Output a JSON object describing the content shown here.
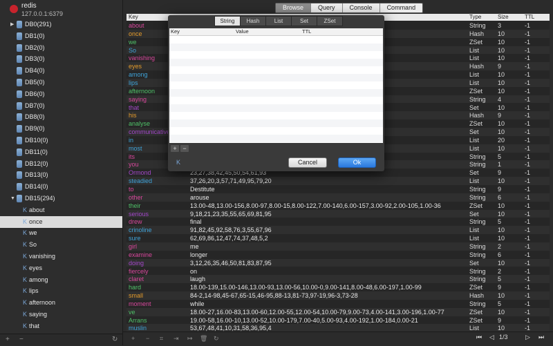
{
  "server": {
    "name": "redis",
    "address": "127.0.0.1:6379"
  },
  "databases": [
    {
      "label": "DB0(291)",
      "expanded": false
    },
    {
      "label": "DB1(0)"
    },
    {
      "label": "DB2(0)"
    },
    {
      "label": "DB3(0)"
    },
    {
      "label": "DB4(0)"
    },
    {
      "label": "DB5(0)"
    },
    {
      "label": "DB6(0)"
    },
    {
      "label": "DB7(0)"
    },
    {
      "label": "DB8(0)"
    },
    {
      "label": "DB9(0)"
    },
    {
      "label": "DB10(0)"
    },
    {
      "label": "DB11(0)"
    },
    {
      "label": "DB12(0)"
    },
    {
      "label": "DB13(0)"
    },
    {
      "label": "DB14(0)"
    },
    {
      "label": "DB15(294)",
      "expanded": true
    }
  ],
  "db15_keys": [
    "about",
    "once",
    "we",
    "So",
    "vanishing",
    "eyes",
    "among",
    "lips",
    "afternoon",
    "saying",
    "that"
  ],
  "selected_key": "once",
  "key_icon_glyph": "K",
  "main_tabs": [
    "Browse",
    "Query",
    "Console",
    "Command"
  ],
  "active_main_tab": "Browse",
  "table": {
    "columns": {
      "key": "Key",
      "type": "Type",
      "size": "Size",
      "ttl": "TTL"
    },
    "rows": [
      {
        "key": "about",
        "color": "#d8479c",
        "value": "",
        "type": "String",
        "size": "3",
        "ttl": "-1"
      },
      {
        "key": "once",
        "color": "#e39a2b",
        "value": "",
        "type": "Hash",
        "size": "10",
        "ttl": "-1"
      },
      {
        "key": "we",
        "color": "#4fc168",
        "value": "4.00-64,2.00-97,1.00-174",
        "type": "ZSet",
        "size": "10",
        "ttl": "-1"
      },
      {
        "key": "So",
        "color": "#3fa3d9",
        "value": "",
        "type": "List",
        "size": "10",
        "ttl": "-1"
      },
      {
        "key": "vanishing",
        "color": "#d8479c",
        "value": "",
        "type": "List",
        "size": "10",
        "ttl": "-1"
      },
      {
        "key": "eyes",
        "color": "#e39a2b",
        "value": "",
        "type": "Hash",
        "size": "9",
        "ttl": "-1"
      },
      {
        "key": "among",
        "color": "#3fa3d9",
        "value": "",
        "type": "List",
        "size": "10",
        "ttl": "-1"
      },
      {
        "key": "lips",
        "color": "#3fa3d9",
        "value": "",
        "type": "List",
        "size": "10",
        "ttl": "-1"
      },
      {
        "key": "afternoon",
        "color": "#4fc168",
        "value": "8.00-117,6.00-128,1.00-14",
        "type": "ZSet",
        "size": "10",
        "ttl": "-1"
      },
      {
        "key": "saying",
        "color": "#d8479c",
        "value": "",
        "type": "String",
        "size": "4",
        "ttl": "-1"
      },
      {
        "key": "that",
        "color": "#a347c9",
        "value": "",
        "type": "Set",
        "size": "10",
        "ttl": "-1"
      },
      {
        "key": "his",
        "color": "#e39a2b",
        "value": "",
        "type": "Hash",
        "size": "9",
        "ttl": "-1"
      },
      {
        "key": "analyse",
        "color": "#4fc168",
        "value": "00-27,3.00-6,0.00-191",
        "type": "ZSet",
        "size": "10",
        "ttl": "-1"
      },
      {
        "key": "communicative",
        "color": "#a347c9",
        "value": "",
        "type": "Set",
        "size": "10",
        "ttl": "-1"
      },
      {
        "key": "in",
        "color": "#3fa3d9",
        "value": "",
        "type": "List",
        "size": "20",
        "ttl": "-1"
      },
      {
        "key": "most",
        "color": "#3fa3d9",
        "value": "",
        "type": "List",
        "size": "10",
        "ttl": "-1"
      },
      {
        "key": "its",
        "color": "#d8479c",
        "value": "",
        "type": "String",
        "size": "5",
        "ttl": "-1"
      },
      {
        "key": "you",
        "color": "#d8479c",
        "value": "",
        "type": "String",
        "size": "1",
        "ttl": "-1"
      },
      {
        "key": "Ormond",
        "color": "#a347c9",
        "value": "23,27,38,42,45,50,54,61,93",
        "type": "Set",
        "size": "9",
        "ttl": "-1"
      },
      {
        "key": "steadied",
        "color": "#3fa3d9",
        "value": "37,26,20,3,57,71,49,95,79,20",
        "type": "List",
        "size": "10",
        "ttl": "-1"
      },
      {
        "key": "to",
        "color": "#d8479c",
        "value": "Destitute",
        "type": "String",
        "size": "9",
        "ttl": "-1"
      },
      {
        "key": "other",
        "color": "#d8479c",
        "value": "arouse",
        "type": "String",
        "size": "6",
        "ttl": "-1"
      },
      {
        "key": "their",
        "color": "#4fc168",
        "value": "13.00-48,13.00-156,8.00-97,8.00-15,8.00-122,7.00-140,6.00-157,3.00-92,2.00-105,1.00-36",
        "type": "ZSet",
        "size": "10",
        "ttl": "-1"
      },
      {
        "key": "serious",
        "color": "#a347c9",
        "value": "9,18,21,23,35,55,65,69,81,95",
        "type": "Set",
        "size": "10",
        "ttl": "-1"
      },
      {
        "key": "drew",
        "color": "#d8479c",
        "value": "final",
        "type": "String",
        "size": "5",
        "ttl": "-1"
      },
      {
        "key": "crinoline",
        "color": "#3fa3d9",
        "value": "91,82,45,92,58,76,3,55,67,96",
        "type": "List",
        "size": "10",
        "ttl": "-1"
      },
      {
        "key": "sure",
        "color": "#3fa3d9",
        "value": "62,69,86,12,47,74,37,48,5,2",
        "type": "List",
        "size": "10",
        "ttl": "-1"
      },
      {
        "key": "girl",
        "color": "#d8479c",
        "value": "me",
        "type": "String",
        "size": "2",
        "ttl": "-1"
      },
      {
        "key": "examine",
        "color": "#d8479c",
        "value": "longer",
        "type": "String",
        "size": "6",
        "ttl": "-1"
      },
      {
        "key": "doing",
        "color": "#a347c9",
        "value": "3,12,26,35,46,50,81,83,87,95",
        "type": "Set",
        "size": "10",
        "ttl": "-1"
      },
      {
        "key": "fiercely",
        "color": "#d8479c",
        "value": "on",
        "type": "String",
        "size": "2",
        "ttl": "-1"
      },
      {
        "key": "claret",
        "color": "#d8479c",
        "value": "laugh",
        "type": "String",
        "size": "5",
        "ttl": "-1"
      },
      {
        "key": "hard",
        "color": "#4fc168",
        "value": "18.00-139,15.00-146,13.00-93,13.00-56,10.00-0,9.00-141,8.00-48,6.00-197,1.00-99",
        "type": "ZSet",
        "size": "9",
        "ttl": "-1"
      },
      {
        "key": "small",
        "color": "#e39a2b",
        "value": "84-2,14-98,45-67,65-15,46-95,88-13,81-73,97-19,96-3,73-28",
        "type": "Hash",
        "size": "10",
        "ttl": "-1"
      },
      {
        "key": "moment",
        "color": "#d8479c",
        "value": "while",
        "type": "String",
        "size": "5",
        "ttl": "-1"
      },
      {
        "key": "ve",
        "color": "#4fc168",
        "value": "18.00-27,16.00-83,13.00-60,12.00-55,12.00-54,10.00-79,9.00-73,4.00-141,3.00-196,1.00-77",
        "type": "ZSet",
        "size": "10",
        "ttl": "-1"
      },
      {
        "key": "Arrans",
        "color": "#4fc168",
        "value": "19.00-58,16.00-10,13.00-52,10.00-179,7.00-40,5.00-93,4.00-192,1.00-184,0.00-21",
        "type": "ZSet",
        "size": "9",
        "ttl": "-1"
      },
      {
        "key": "muslin",
        "color": "#3fa3d9",
        "value": "53,67,48,41,10,31,58,36,95,4",
        "type": "List",
        "size": "10",
        "ttl": "-1"
      }
    ]
  },
  "pager": {
    "first": "⏮",
    "prev": "◁",
    "current": "1/3",
    "next": "▷",
    "last": "⏭"
  },
  "bottom_toolbar": {
    "add": "+",
    "remove": "−",
    "filter": "⌗",
    "import": "⇥",
    "export": "↦",
    "delete": "🗑",
    "refresh": "↻"
  },
  "sidebar_toolbar": {
    "add": "+",
    "remove": "−",
    "refresh": "↻"
  },
  "modal": {
    "tabs": [
      "String",
      "Hash",
      "List",
      "Set",
      "ZSet"
    ],
    "active_tab": "String",
    "columns": {
      "key": "Key",
      "value": "Value",
      "ttl": "TTL"
    },
    "add_label": "+",
    "remove_label": "−",
    "key_icon": "K",
    "cancel_label": "Cancel",
    "ok_label": "Ok"
  },
  "colors": {
    "string": "#d8479c",
    "hash": "#e39a2b",
    "zset": "#4fc168",
    "list": "#3fa3d9",
    "set": "#a347c9",
    "accent": "#2a78dd"
  }
}
